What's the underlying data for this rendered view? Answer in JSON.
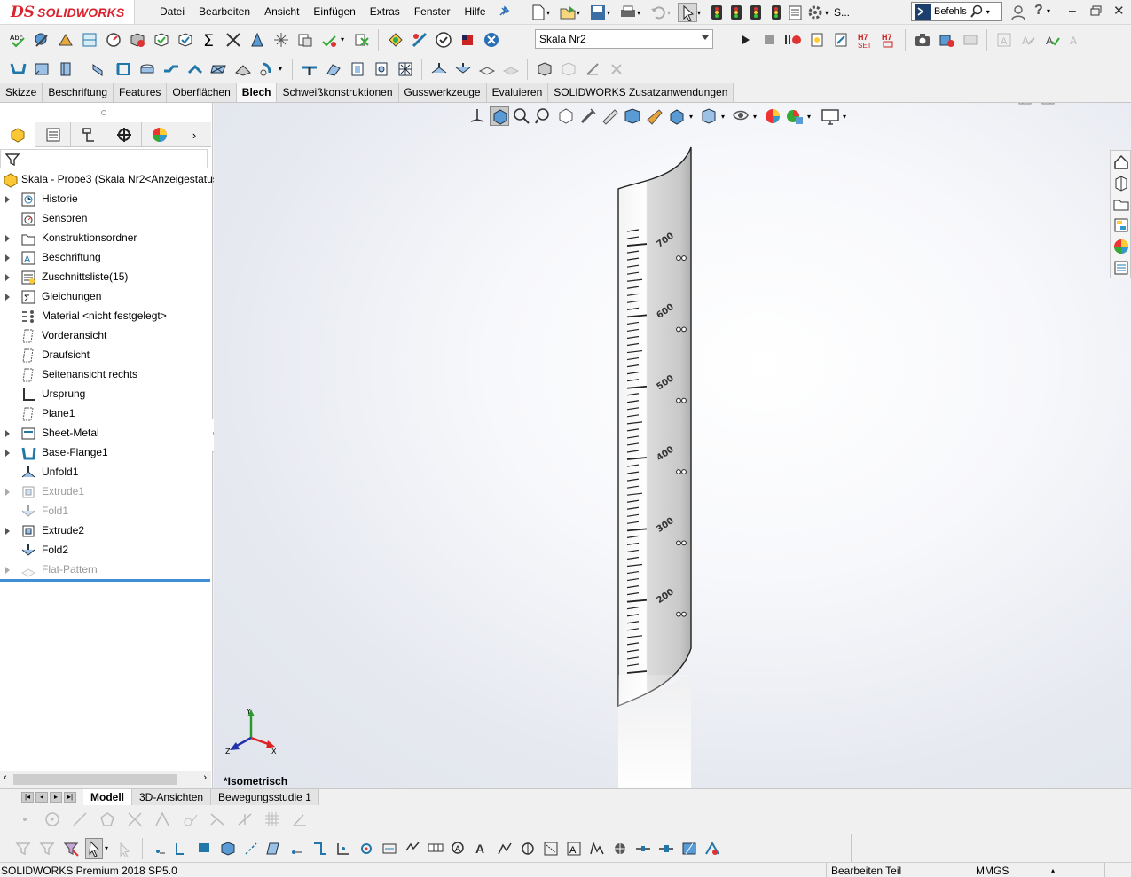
{
  "app": {
    "brand_ds": "DS",
    "brand_name": "SOLIDWORKS"
  },
  "menu": [
    "Datei",
    "Bearbeiten",
    "Ansicht",
    "Einfügen",
    "Extras",
    "Fenster",
    "Hilfe"
  ],
  "search": {
    "label": "Befehls"
  },
  "config_combo": {
    "value": "Skala Nr2"
  },
  "command_tabs": [
    {
      "label": "Skizze",
      "active": false
    },
    {
      "label": "Beschriftung",
      "active": false
    },
    {
      "label": "Features",
      "active": false
    },
    {
      "label": "Oberflächen",
      "active": false
    },
    {
      "label": "Blech",
      "active": true
    },
    {
      "label": "Schweißkonstruktionen",
      "active": false
    },
    {
      "label": "Gusswerkzeuge",
      "active": false
    },
    {
      "label": "Evaluieren",
      "active": false
    },
    {
      "label": "SOLIDWORKS Zusatzanwendungen",
      "active": false
    }
  ],
  "tree": {
    "root": "Skala - Probe3  (Skala Nr2<Anzeigestatus",
    "items": [
      {
        "label": "Historie",
        "expand": true,
        "dim": false,
        "icon": "history-icon"
      },
      {
        "label": "Sensoren",
        "expand": false,
        "dim": false,
        "icon": "sensor-icon"
      },
      {
        "label": "Konstruktionsordner",
        "expand": true,
        "dim": false,
        "icon": "folder-icon"
      },
      {
        "label": "Beschriftung",
        "expand": true,
        "dim": false,
        "icon": "annotation-icon"
      },
      {
        "label": "Zuschnittsliste(15)",
        "expand": true,
        "dim": false,
        "icon": "cutlist-icon"
      },
      {
        "label": "Gleichungen",
        "expand": true,
        "dim": false,
        "icon": "equation-icon"
      },
      {
        "label": "Material <nicht festgelegt>",
        "expand": false,
        "dim": false,
        "icon": "material-icon"
      },
      {
        "label": "Vorderansicht",
        "expand": false,
        "dim": false,
        "icon": "plane-icon"
      },
      {
        "label": "Draufsicht",
        "expand": false,
        "dim": false,
        "icon": "plane-icon"
      },
      {
        "label": "Seitenansicht rechts",
        "expand": false,
        "dim": false,
        "icon": "plane-icon"
      },
      {
        "label": "Ursprung",
        "expand": false,
        "dim": false,
        "icon": "origin-icon"
      },
      {
        "label": "Plane1",
        "expand": false,
        "dim": false,
        "icon": "plane-icon"
      },
      {
        "label": "Sheet-Metal",
        "expand": true,
        "dim": false,
        "icon": "sheetmetal-icon"
      },
      {
        "label": "Base-Flange1",
        "expand": true,
        "dim": false,
        "icon": "base-flange-icon"
      },
      {
        "label": "Unfold1",
        "expand": false,
        "dim": false,
        "icon": "unfold-icon"
      },
      {
        "label": "Extrude1",
        "expand": true,
        "dim": true,
        "icon": "extrude-icon"
      },
      {
        "label": "Fold1",
        "expand": false,
        "dim": true,
        "icon": "fold-icon"
      },
      {
        "label": "Extrude2",
        "expand": true,
        "dim": false,
        "icon": "extrude-icon"
      },
      {
        "label": "Fold2",
        "expand": false,
        "dim": false,
        "icon": "fold-icon"
      },
      {
        "label": "Flat-Pattern",
        "expand": true,
        "dim": true,
        "icon": "flat-pattern-icon"
      }
    ]
  },
  "scale_labels": [
    "700",
    "600",
    "500",
    "400",
    "300",
    "200"
  ],
  "triad": {
    "x": "X",
    "y": "Y",
    "z": "Z"
  },
  "view_label": "*Isometrisch",
  "bottom_tabs": [
    {
      "label": "Modell",
      "active": true
    },
    {
      "label": "3D-Ansichten",
      "active": false
    },
    {
      "label": "Bewegungsstudie 1",
      "active": false
    }
  ],
  "status": {
    "product": "SOLIDWORKS Premium 2018 SP5.0",
    "mode": "Bearbeiten Teil",
    "units": "MMGS"
  },
  "colors": {
    "accent_red": "#d9232e",
    "selection_blue": "#3f8fd6"
  }
}
